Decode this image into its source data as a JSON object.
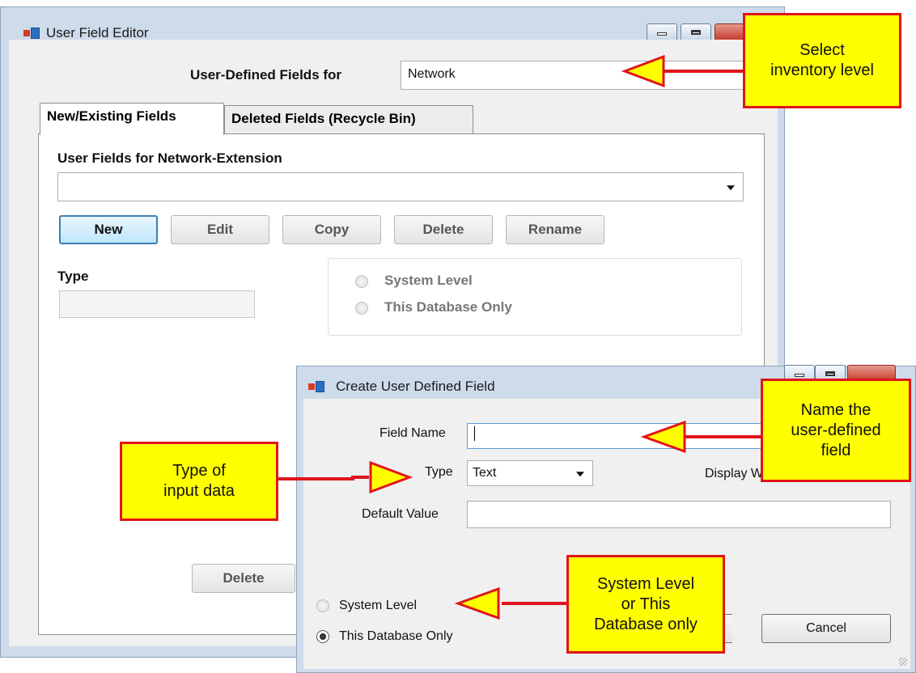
{
  "main_window": {
    "title": "User Field Editor",
    "inventory_label": "User-Defined Fields for",
    "inventory_value": "Network",
    "tabs": [
      "New/Existing Fields",
      "Deleted Fields (Recycle Bin)"
    ],
    "fields_label": "User Fields for Network-Extension",
    "fields_value": "",
    "buttons": {
      "new": "New",
      "edit": "Edit",
      "copy": "Copy",
      "delete": "Delete",
      "rename": "Rename"
    },
    "type_label": "Type",
    "type_value": "",
    "scope": {
      "system": "System Level",
      "database": "This Database Only"
    },
    "bottom_delete": "Delete"
  },
  "dialog": {
    "title": "Create User Defined Field",
    "field_name_label": "Field Name",
    "field_name_value": "",
    "type_label": "Type",
    "type_value": "Text",
    "display_label": "Display W",
    "default_value_label": "Default Value",
    "default_value": "",
    "scope": {
      "system": "System Level",
      "database": "This Database Only",
      "selected": "database"
    },
    "cancel": "Cancel"
  },
  "callouts": {
    "inventory": [
      "Select",
      "inventory level"
    ],
    "name": [
      "Name the",
      "user-defined",
      "field"
    ],
    "type": [
      "Type of",
      "input data"
    ],
    "scope": [
      "System Level",
      "or This",
      "Database only"
    ]
  },
  "colors": {
    "callout_fill": "#ffff00",
    "callout_border": "#e0151b",
    "arrow": "#e0151b"
  }
}
